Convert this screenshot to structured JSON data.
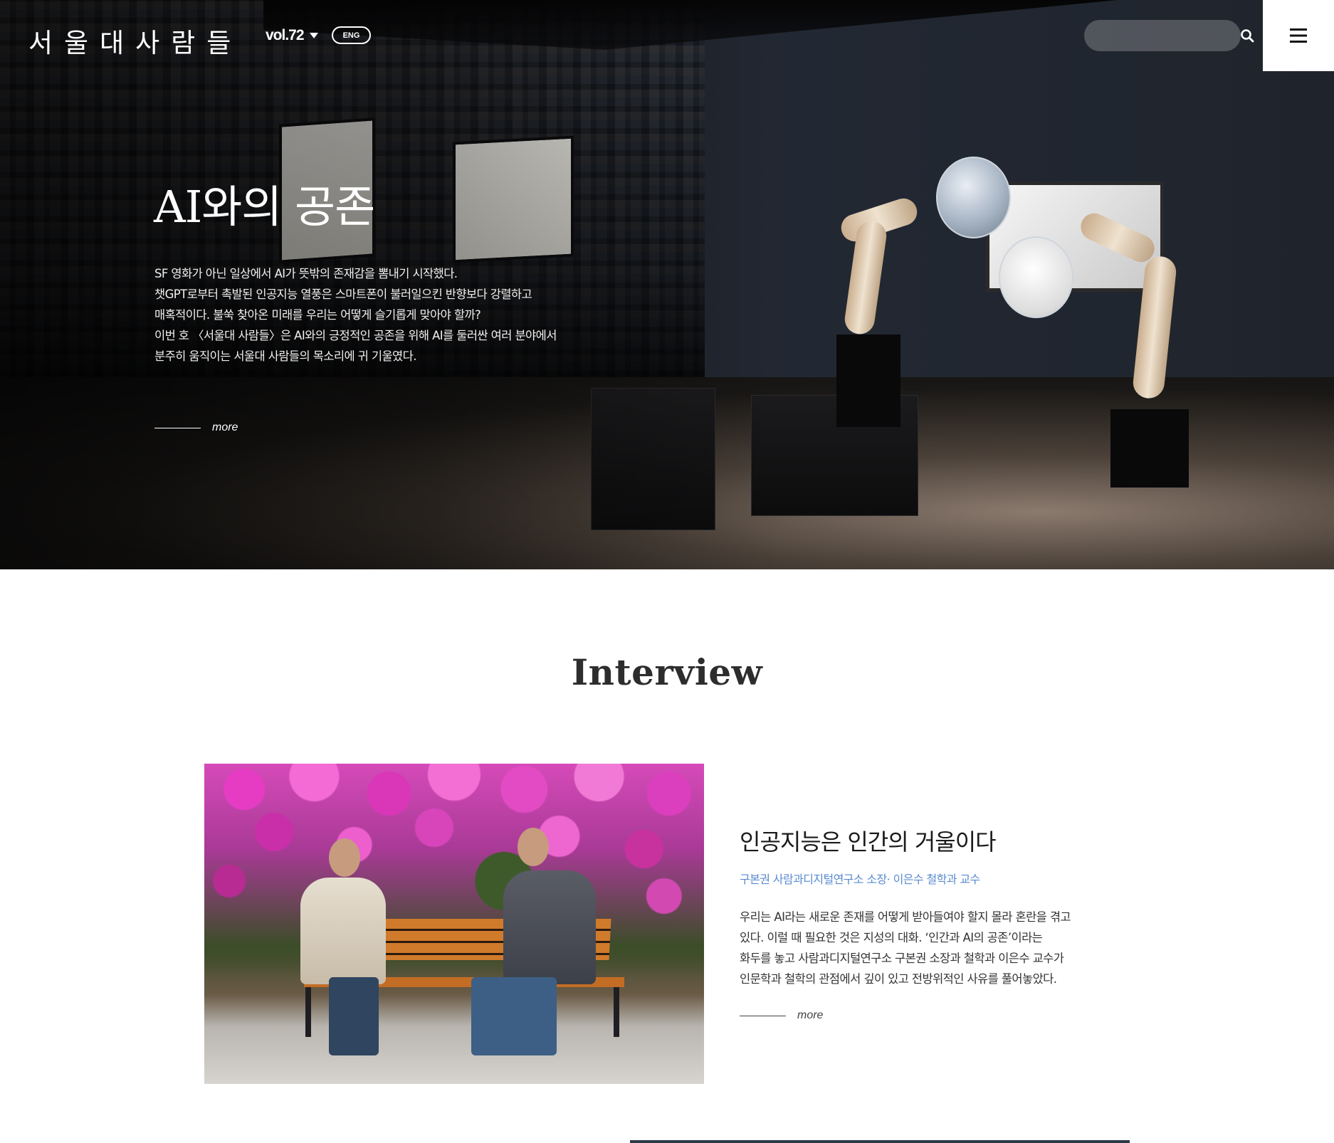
{
  "header": {
    "logo": "서울대사람들",
    "volume": "vol.72",
    "lang_button": "ENG",
    "search": {
      "placeholder": "",
      "value": ""
    }
  },
  "hero": {
    "title": "AI와의 공존",
    "description_lines": [
      "SF 영화가 아닌 일상에서 AI가 뜻밖의 존재감을 뽐내기 시작했다.",
      "챗GPT로부터 촉발된 인공지능 열풍은 스마트폰이 불러일으킨 반향보다 강렬하고",
      "매혹적이다. 불쑥 찾아온 미래를 우리는 어떻게 슬기롭게 맞아야 할까?",
      "이번 호 〈서울대 사람들〉은 AI와의 긍정적인 공존을 위해 AI를 둘러싼 여러 분야에서",
      "분주히 움직이는 서울대 사람들의 목소리에 귀 기울였다."
    ],
    "more": "more"
  },
  "interview": {
    "section_title": "Interview",
    "title": "인공지능은 인간의 거울이다",
    "subtitle": "구본권 사람과디지털연구소 소장· 이은수 철학과 교수",
    "description_lines": [
      "우리는 AI라는 새로운 존재를 어떻게 받아들여야 할지 몰라 혼란을 겪고",
      "있다. 이럴 때 필요한 것은 지성의 대화. ‘인간과 AI의 공존’이라는",
      "화두를 놓고 사람과디지털연구소 구본권 소장과 철학과 이은수 교수가",
      "인문학과 철학의 관점에서 깊이 있고 전방위적인 사유를 풀어놓았다."
    ],
    "more": "more"
  },
  "colors": {
    "accent_blue": "#5a8bd0",
    "title_dark": "#2d2d2d",
    "bar": "#2c3b49"
  },
  "icons": {
    "search": "search-icon",
    "menu": "hamburger-menu-icon",
    "dropdown": "caret-down-icon"
  }
}
